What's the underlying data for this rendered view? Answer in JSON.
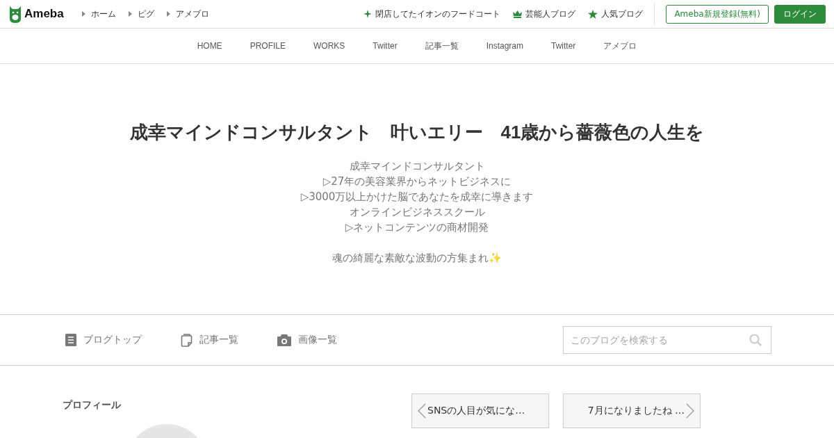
{
  "header": {
    "logo": "Ameba",
    "breadcrumbs": [
      "ホーム",
      "ピグ",
      "アメブロ"
    ],
    "featured_links": [
      {
        "kind": "sparkle",
        "label": "閉店してたイオンのフードコート"
      },
      {
        "kind": "crown",
        "label": "芸能人ブログ"
      },
      {
        "kind": "star",
        "label": "人気ブログ"
      }
    ],
    "register_button": "Ameba新規登録(無料)",
    "login_button": "ログイン"
  },
  "nav": [
    "HOME",
    "PROFILE",
    "WORKS",
    "Twitter",
    "記事一覧",
    "Instagram",
    "Twitter",
    "アメブロ"
  ],
  "hero": {
    "title": "成幸マインドコンサルタント　叶いエリー　41歳から薔薇色の人生を",
    "description": [
      "成幸マインドコンサルタント",
      "▷27年の美容業界からネットビジネスに",
      "▷3000万以上かけた脳であなたを成幸に導きます",
      "オンラインビジネススクール",
      "▷ネットコンテンツの商材開発"
    ],
    "tagline": "魂の綺麗な素敵な波動の方集まれ✨"
  },
  "toolbar": {
    "links": [
      {
        "kind": "document",
        "label": "ブログトップ"
      },
      {
        "kind": "pages",
        "label": "記事一覧"
      },
      {
        "kind": "camera",
        "label": "画像一覧"
      }
    ],
    "search": {
      "placeholder": "このブログを検索する"
    }
  },
  "profile": {
    "heading": "プロフィール"
  },
  "pager": {
    "previous": "SNSの人目が気にな…",
    "next": "7月になりましたね …"
  }
}
